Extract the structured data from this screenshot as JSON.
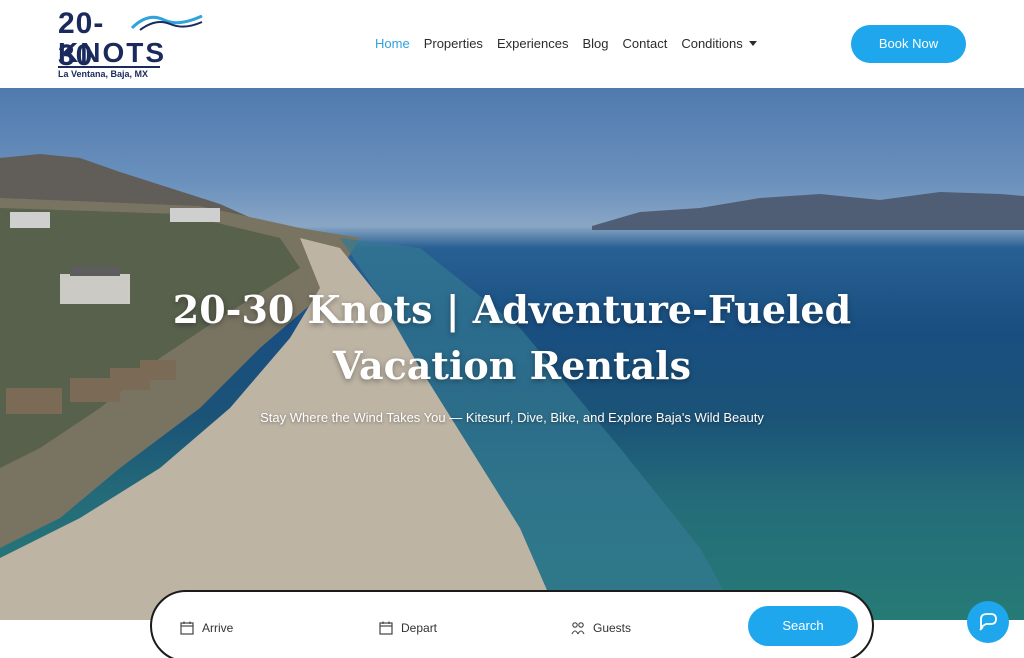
{
  "logo": {
    "number": "20-30",
    "word": "KNOTS",
    "tagline": "La Ventana, Baja, MX",
    "icon": "wave-icon"
  },
  "nav": {
    "items": [
      {
        "label": "Home",
        "active": true
      },
      {
        "label": "Properties",
        "active": false
      },
      {
        "label": "Experiences",
        "active": false
      },
      {
        "label": "Blog",
        "active": false
      },
      {
        "label": "Contact",
        "active": false
      },
      {
        "label": "Conditions",
        "active": false,
        "icon": "chevron-down-icon"
      }
    ]
  },
  "cta": {
    "book_label": "Book Now"
  },
  "hero": {
    "title": "20-30 Knots | Adventure-Fueled Vacation Rentals",
    "subtitle": "Stay Where the Wind Takes You — Kitesurf, Dive, Bike, and Explore Baja's Wild Beauty"
  },
  "search": {
    "arrive_label": "Arrive",
    "arrive_icon": "calendar-icon",
    "depart_label": "Depart",
    "depart_icon": "calendar-icon",
    "guests_label": "Guests",
    "guests_icon": "guests-icon",
    "button_label": "Search"
  },
  "chat": {
    "icon": "chat-icon"
  },
  "colors": {
    "accent": "#1ea7ec",
    "nav_active": "#2ea3dc",
    "brand_navy": "#1b2a5c"
  }
}
